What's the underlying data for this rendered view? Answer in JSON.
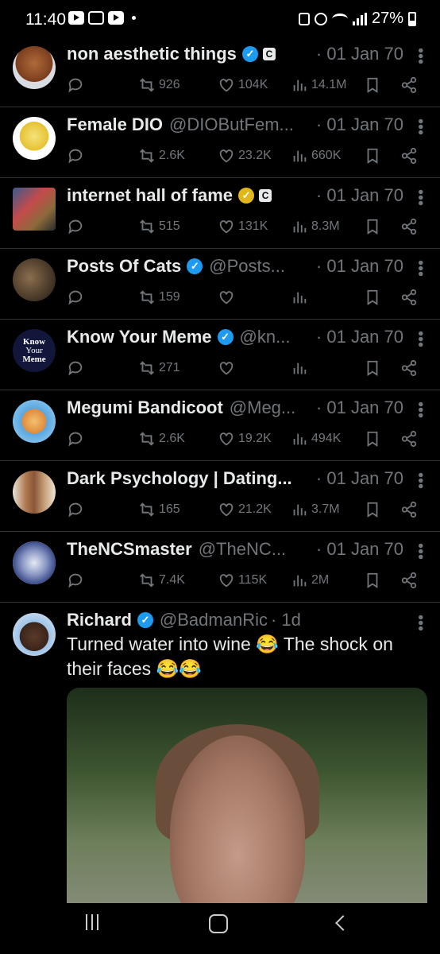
{
  "status": {
    "time": "11:40",
    "battery": "27%"
  },
  "tweets": [
    {
      "name": "non aesthetic things",
      "badge": "blue",
      "affiliate": "C",
      "handle": "",
      "date": "· 01 Jan 70",
      "retweets": "926",
      "likes": "104K",
      "views": "14.1M"
    },
    {
      "name": "Female DIO",
      "badge": "",
      "affiliate": "",
      "handle": "@DIOButFem...",
      "date": "· 01 Jan 70",
      "retweets": "2.6K",
      "likes": "23.2K",
      "views": "660K"
    },
    {
      "name": "internet hall of fame",
      "badge": "gold",
      "affiliate": "C",
      "handle": "",
      "date": "· 01 Jan 70",
      "retweets": "515",
      "likes": "131K",
      "views": "8.3M"
    },
    {
      "name": "Posts Of Cats",
      "badge": "blue",
      "affiliate": "",
      "handle": "@Posts...",
      "date": "· 01 Jan 70",
      "retweets": "159",
      "likes": "",
      "views": ""
    },
    {
      "name": "Know Your Meme",
      "badge": "blue",
      "affiliate": "",
      "handle": "@kn...",
      "date": "· 01 Jan 70",
      "retweets": "271",
      "likes": "",
      "views": ""
    },
    {
      "name": "Megumi Bandicoot",
      "badge": "",
      "affiliate": "",
      "handle": "@Meg...",
      "date": "· 01 Jan 70",
      "retweets": "2.6K",
      "likes": "19.2K",
      "views": "494K"
    },
    {
      "name": "Dark Psychology | Dating...",
      "badge": "",
      "affiliate": "",
      "handle": "",
      "date": "· 01 Jan 70",
      "retweets": "165",
      "likes": "21.2K",
      "views": "3.7M"
    },
    {
      "name": "TheNCSmaster",
      "badge": "",
      "affiliate": "",
      "handle": "@TheNC...",
      "date": "· 01 Jan 70",
      "retweets": "7.4K",
      "likes": "115K",
      "views": "2M"
    }
  ],
  "full_tweet": {
    "name": "Richard",
    "handle": "@BadmanRic",
    "date": "· 1d",
    "text": "Turned water into wine 😂 The shock on their faces 😂😂"
  },
  "avatars": {
    "kym_line1": "Know",
    "kym_line2": "Your",
    "kym_line3": "Meme"
  },
  "colors": {
    "accent": "#1d9bf0",
    "gold": "#e2b719",
    "muted": "#71767b",
    "divider": "#2f3336"
  }
}
